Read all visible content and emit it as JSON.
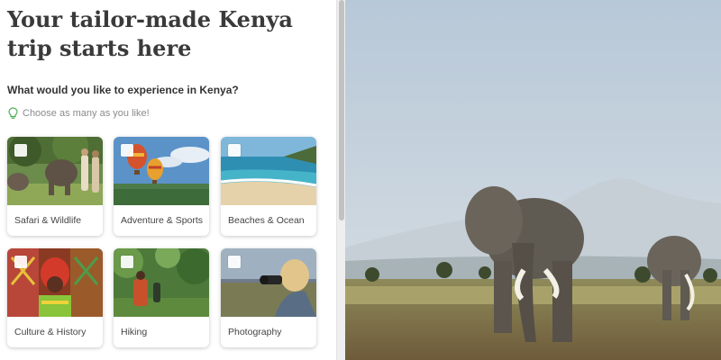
{
  "hero": {
    "title": "Your tailor-made Kenya trip starts here"
  },
  "question": {
    "text": "What would you like to experience in Kenya?"
  },
  "hint": {
    "text": "Choose as many as you like!",
    "icon": "lightbulb-icon"
  },
  "options": [
    {
      "label": "Safari & Wildlife"
    },
    {
      "label": "Adventure & Sports"
    },
    {
      "label": "Beaches & Ocean"
    },
    {
      "label": "Culture & History"
    },
    {
      "label": "Hiking"
    },
    {
      "label": "Photography"
    }
  ],
  "colors": {
    "title": "#3a3a3a",
    "hint_icon": "#4caf50",
    "text": "#333333"
  }
}
